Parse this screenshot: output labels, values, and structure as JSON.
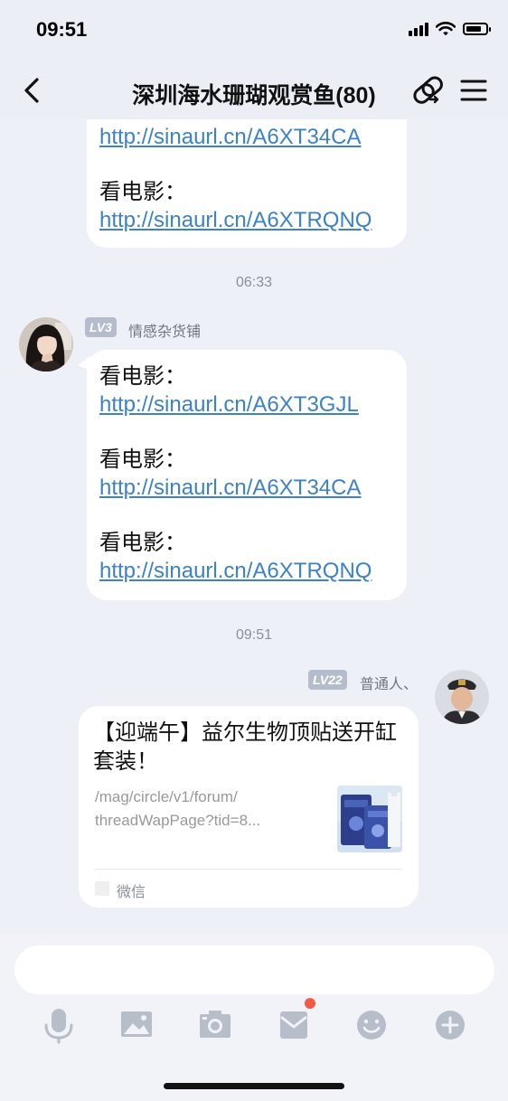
{
  "status": {
    "time": "09:51"
  },
  "nav": {
    "title": "深圳海水珊瑚观赏鱼(80)"
  },
  "messages": {
    "first": {
      "link1": "http://sinaurl.cn/A6XT34CA",
      "label2": "看电影：",
      "link2": "http://sinaurl.cn/A6XTRQNQ"
    },
    "time1": "06:33",
    "second": {
      "level": "LV3",
      "sender": "情感杂货铺",
      "items": [
        {
          "label": "看电影：",
          "link": "http://sinaurl.cn/A6XT3GJL"
        },
        {
          "label": "看电影：",
          "link": "http://sinaurl.cn/A6XT34CA"
        },
        {
          "label": "看电影：",
          "link": "http://sinaurl.cn/A6XTRQNQ"
        }
      ]
    },
    "time2": "09:51",
    "third": {
      "level": "LV22",
      "sender": "普通人、",
      "card": {
        "title": "【迎端午】益尔生物顶贴送开缸套装！",
        "url": "/mag/circle/v1/forum/threadWapPage?tid=8...",
        "url_line1": "/mag/circle/v1/forum/",
        "url_line2": "threadWapPage?tid=8...",
        "source": "微信"
      }
    }
  },
  "input": {
    "placeholder": ""
  },
  "toolbar": {
    "icons": [
      "microphone-icon",
      "image-icon",
      "camera-icon",
      "red-packet-icon",
      "emoji-icon",
      "plus-icon"
    ],
    "red_packet_has_badge": true
  },
  "colors": {
    "link": "#3d82c4",
    "badge": "#f15a45",
    "level_badge": "#b5bccb"
  }
}
